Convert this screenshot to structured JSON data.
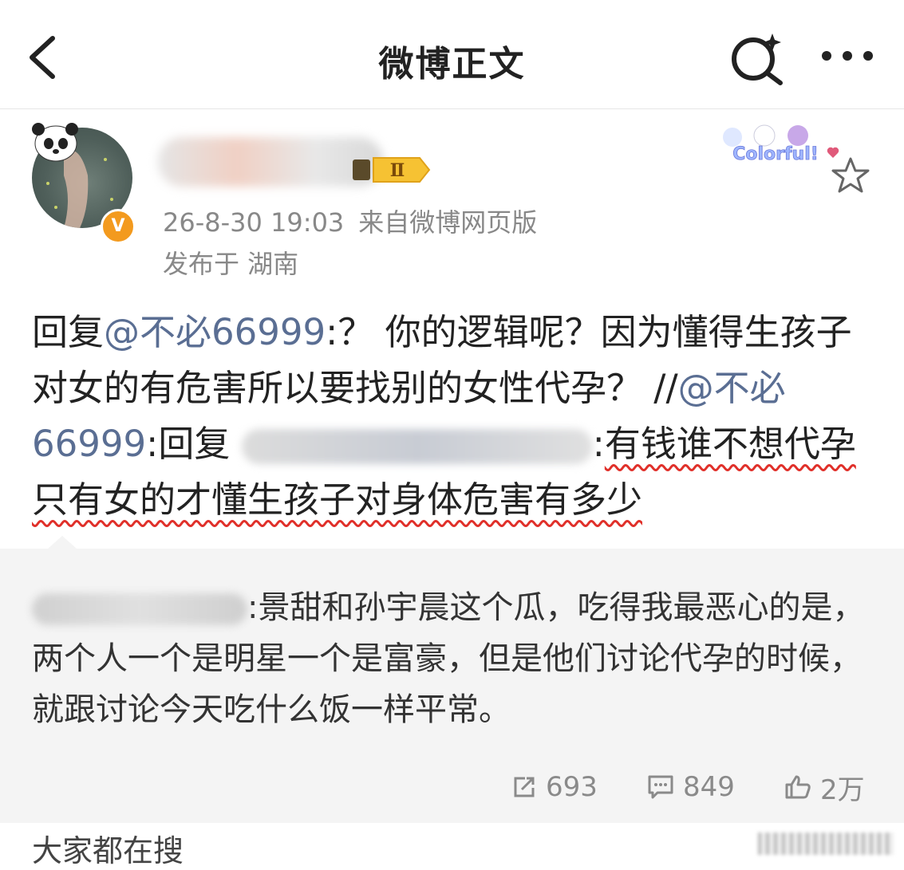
{
  "header": {
    "title": "微博正文",
    "back_icon": "back-arrow-icon",
    "search_icon": "search-sparkle-icon",
    "more_icon": "more-dots-icon"
  },
  "post": {
    "level_badge": "Ⅱ",
    "verified_badge": "V",
    "timestamp": "26-8-30 19:03",
    "source": "来自微博网页版",
    "location": "发布于 湖南",
    "decor_label": "Colorful!",
    "body": {
      "p1": "回复",
      "mention1": "@不必66999",
      "p2": ":？ 你的逻辑呢？因为懂得生孩子对女的有危害所以要找别的女性代孕？ //",
      "mention2": "@不必66999",
      "p3": ":回复",
      "p4": ":",
      "underlined": "有钱谁不想代孕 只有女的才懂生孩子对身体危害有多少"
    }
  },
  "retweet": {
    "text": ":景甜和孙宇晨这个瓜，吃得我最恶心的是，两个人一个是明星一个是富豪，但是他们讨论代孕的时候，就跟讨论今天吃什么饭一样平常。",
    "reposts": "693",
    "comments": "849",
    "likes": "2万"
  },
  "bottom": {
    "label": "大家都在搜"
  },
  "colors": {
    "link": "#5a6e93",
    "underline": "#e0302a",
    "retweet_bg": "#f4f4f4",
    "verified": "#f39a1e"
  }
}
